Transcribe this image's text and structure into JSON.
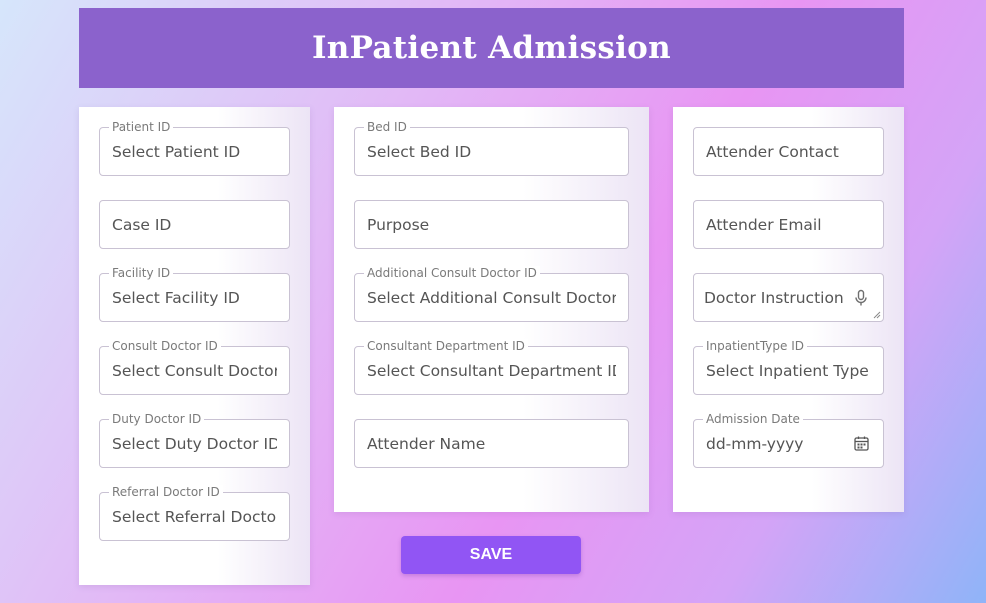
{
  "header": {
    "title": "InPatient Admission"
  },
  "col1": {
    "patient_id": {
      "label": "Patient ID",
      "placeholder": "Select Patient ID"
    },
    "case_id": {
      "placeholder": "Case ID"
    },
    "facility_id": {
      "label": "Facility ID",
      "placeholder": "Select Facility ID"
    },
    "consult_doctor_id": {
      "label": "Consult Doctor ID",
      "placeholder": "Select Consult Doctor ID"
    },
    "duty_doctor_id": {
      "label": "Duty Doctor ID",
      "placeholder": "Select Duty Doctor ID"
    },
    "referral_doctor_id": {
      "label": "Referral Doctor ID",
      "placeholder": "Select Referral Doctor ID"
    }
  },
  "col2": {
    "bed_id": {
      "label": "Bed ID",
      "placeholder": "Select Bed ID"
    },
    "purpose": {
      "placeholder": "Purpose"
    },
    "additional_consult_doctor_id": {
      "label": "Additional Consult Doctor ID",
      "placeholder": "Select Additional Consult Doctor ID"
    },
    "consultant_department_id": {
      "label": "Consultant Department ID",
      "placeholder": "Select Consultant Department ID"
    },
    "attender_name": {
      "placeholder": "Attender Name"
    }
  },
  "col3": {
    "attender_contact": {
      "placeholder": "Attender Contact"
    },
    "attender_email": {
      "placeholder": "Attender Email"
    },
    "doctor_instruction": {
      "placeholder": "Doctor Instruction"
    },
    "inpatient_type_id": {
      "label": "InpatientType ID",
      "placeholder": "Select Inpatient Type ID"
    },
    "admission_date": {
      "label": "Admission Date",
      "placeholder": "dd-mm-yyyy"
    }
  },
  "actions": {
    "save_label": "SAVE"
  },
  "icons": {
    "mic": "microphone-icon",
    "calendar": "calendar-icon"
  },
  "colors": {
    "header": "#8b62cc",
    "save_button": "#9155f4"
  }
}
